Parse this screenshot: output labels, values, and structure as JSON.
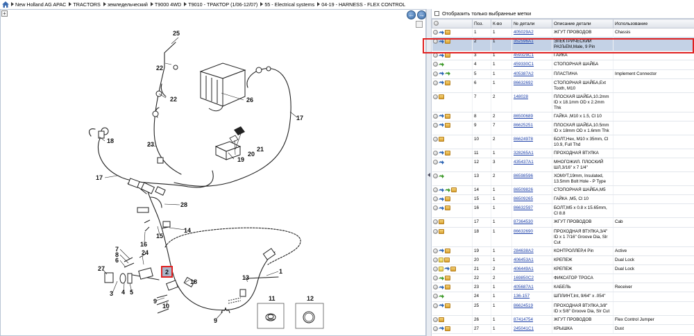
{
  "breadcrumb": [
    "New Holland AG APAC",
    "TRACTORS",
    "земледельческий",
    "T9000 4WD",
    "T9010 - ТРАКТОР (1/06-12/07)",
    "55 - Electrical systems",
    "04-19 - HARNESS - FLEX CONTROL"
  ],
  "diagram": {
    "callouts": [
      "25",
      "22",
      "22",
      "26",
      "17",
      "18",
      "23",
      "21",
      "20",
      "19",
      "17",
      "28",
      "16",
      "15",
      "14",
      "7",
      "8",
      "6",
      "24",
      "27",
      "3",
      "4",
      "5",
      "2",
      "18",
      "13",
      "1",
      "9",
      "10",
      "9",
      "11",
      "12"
    ],
    "highlighted": "2"
  },
  "right": {
    "filter_label": "Отобразить только выбранные метки",
    "columns": [
      "",
      "Поз.",
      "К-во",
      "№ детали",
      "Описание детали",
      "Использование"
    ],
    "rows": [
      {
        "pos": "1",
        "qty": "1",
        "part": "405029A2",
        "desc": "ЖГУТ ПРОВОДОВ",
        "use": "Chassis",
        "icons": [
          "grey",
          "arrow-blue",
          "box"
        ]
      },
      {
        "pos": "2",
        "qty": "1",
        "part": "352596A1",
        "desc": "ЭЛЕКТРИЧЕСКИЙ РАЗЪЕМ,Male, 9 Pin",
        "use": "",
        "icons": [
          "grey",
          "arrow-blue",
          "box"
        ]
      },
      {
        "pos": "3",
        "qty": "1",
        "part": "459329C1",
        "desc": "ГАЙКА",
        "use": "",
        "icons": [
          "grey",
          "arrow-blue",
          "box"
        ]
      },
      {
        "pos": "4",
        "qty": "1",
        "part": "459330C1",
        "desc": "СТОПОРНАЯ ШАЙБА",
        "use": "",
        "icons": [
          "grey",
          "arrow-green"
        ]
      },
      {
        "pos": "5",
        "qty": "1",
        "part": "405387A2",
        "desc": "ПЛАСТИНА",
        "use": "Implement Connector",
        "icons": [
          "grey",
          "arrow-blue",
          "arrow-green"
        ]
      },
      {
        "pos": "6",
        "qty": "1",
        "part": "86632692",
        "desc": "СТОПОРНАЯ ШАЙБА,Ext Tooth, M10",
        "use": "",
        "icons": [
          "grey",
          "arrow-blue",
          "box"
        ]
      },
      {
        "pos": "7",
        "qty": "2",
        "part": "148028",
        "desc": "ПЛОСКАЯ ШАЙБА,10.2mm ID x 18.1mm OD x 2.2mm Thk",
        "use": "",
        "icons": [
          "grey",
          "box"
        ]
      },
      {
        "pos": "8",
        "qty": "2",
        "part": "86500689",
        "desc": "ГАЙКА ,M10 x 1.5, Cl 10",
        "use": "",
        "icons": [
          "grey",
          "arrow-blue",
          "box"
        ]
      },
      {
        "pos": "9",
        "qty": "7",
        "part": "86625251",
        "desc": "ПЛОСКАЯ ШАЙБА,10.5mm ID x 18mm OD x 1.6mm Thk",
        "use": "",
        "icons": [
          "grey",
          "arrow-blue",
          "box"
        ]
      },
      {
        "pos": "10",
        "qty": "2",
        "part": "86624978",
        "desc": "БОЛТ,Hex, M10 x 35mm, Cl 10.9, Full Thd",
        "use": "",
        "icons": [
          "grey",
          "box"
        ]
      },
      {
        "pos": "11",
        "qty": "1",
        "part": "328265A1",
        "desc": "ПРОХОДНАЯ ВТУЛКА",
        "use": "",
        "icons": [
          "grey",
          "arrow-blue",
          "box"
        ]
      },
      {
        "pos": "12",
        "qty": "3",
        "part": "435437A1",
        "desc": "МНОГОЖИЛ. ПЛОСКИЙ ШЛ,3/16\" x 7 1/4\"",
        "use": "",
        "icons": [
          "grey",
          "arrow-blue"
        ]
      },
      {
        "pos": "13",
        "qty": "2",
        "part": "86598596",
        "desc": "ХОМУТ,19mm, Insulated, 13.5mm Bolt Hole - P Type",
        "use": "",
        "icons": [
          "grey",
          "arrow-green"
        ]
      },
      {
        "pos": "14",
        "qty": "1",
        "part": "86509826",
        "desc": "СТОПОРНАЯ ШАЙБА,M5",
        "use": "",
        "icons": [
          "grey",
          "arrow-blue",
          "arrow-green",
          "box"
        ]
      },
      {
        "pos": "15",
        "qty": "1",
        "part": "86509265",
        "desc": "ГАЙКА ,M5, Cl 10",
        "use": "",
        "icons": [
          "grey",
          "arrow-blue",
          "box"
        ]
      },
      {
        "pos": "16",
        "qty": "1",
        "part": "86632597",
        "desc": "БОЛТ,M5 x 0.8 x 15.65mm, Cl 8.8",
        "use": "",
        "icons": [
          "grey",
          "arrow-blue",
          "box"
        ]
      },
      {
        "pos": "17",
        "qty": "1",
        "part": "87364530",
        "desc": "ЖГУТ ПРОВОДОВ",
        "use": "Cab",
        "icons": [
          "grey",
          "box"
        ]
      },
      {
        "pos": "18",
        "qty": "1",
        "part": "86632690",
        "desc": "ПРОХОДНАЯ ВТУЛКА,3/4\" ID x 1 7/16\" Groove Dia, Slr Cut",
        "use": "",
        "icons": [
          "grey",
          "box"
        ]
      },
      {
        "pos": "19",
        "qty": "1",
        "part": "284638A2",
        "desc": "КОНТРОЛЛЕР,4 Pin",
        "use": "Active",
        "icons": [
          "grey",
          "arrow-blue",
          "box"
        ]
      },
      {
        "pos": "20",
        "qty": "1",
        "part": "406453A1",
        "desc": "КРЕПЕЖ",
        "use": "Dual Lock",
        "icons": [
          "grey",
          "note",
          "box"
        ]
      },
      {
        "pos": "21",
        "qty": "2",
        "part": "406449A1",
        "desc": "КРЕПЕЖ",
        "use": "Dual Lock",
        "icons": [
          "grey",
          "note",
          "arrow-blue",
          "box"
        ]
      },
      {
        "pos": "22",
        "qty": "2",
        "part": "169850C2",
        "desc": "ФИКСАТОР ТРОСА",
        "use": "",
        "icons": [
          "grey",
          "arrow-green",
          "box"
        ]
      },
      {
        "pos": "23",
        "qty": "1",
        "part": "405687A1",
        "desc": "КАБЕЛЬ",
        "use": "Receiver",
        "icons": [
          "grey",
          "arrow-blue",
          "box"
        ]
      },
      {
        "pos": "24",
        "qty": "1",
        "part": "136-157",
        "desc": "ШПЛИНТ,Int, 9/64\" x .054\"",
        "use": "",
        "icons": [
          "grey",
          "arrow-green"
        ]
      },
      {
        "pos": "25",
        "qty": "1",
        "part": "86624519",
        "desc": "ПРОХОДНАЯ ВТУЛКА,3/8\" ID x 5/8\" Groove Dia, Slr Cut",
        "use": "",
        "icons": [
          "grey",
          "arrow-blue",
          "box"
        ]
      },
      {
        "pos": "26",
        "qty": "1",
        "part": "87414754",
        "desc": "ЖГУТ ПРОВОДОВ",
        "use": "Flex Control Jumper",
        "icons": [
          "grey",
          "box"
        ]
      },
      {
        "pos": "27",
        "qty": "1",
        "part": "245041C1",
        "desc": "КРЫШКА",
        "use": "Dust",
        "icons": [
          "grey",
          "arrow-blue",
          "box"
        ]
      }
    ],
    "selected_pos": "2"
  }
}
